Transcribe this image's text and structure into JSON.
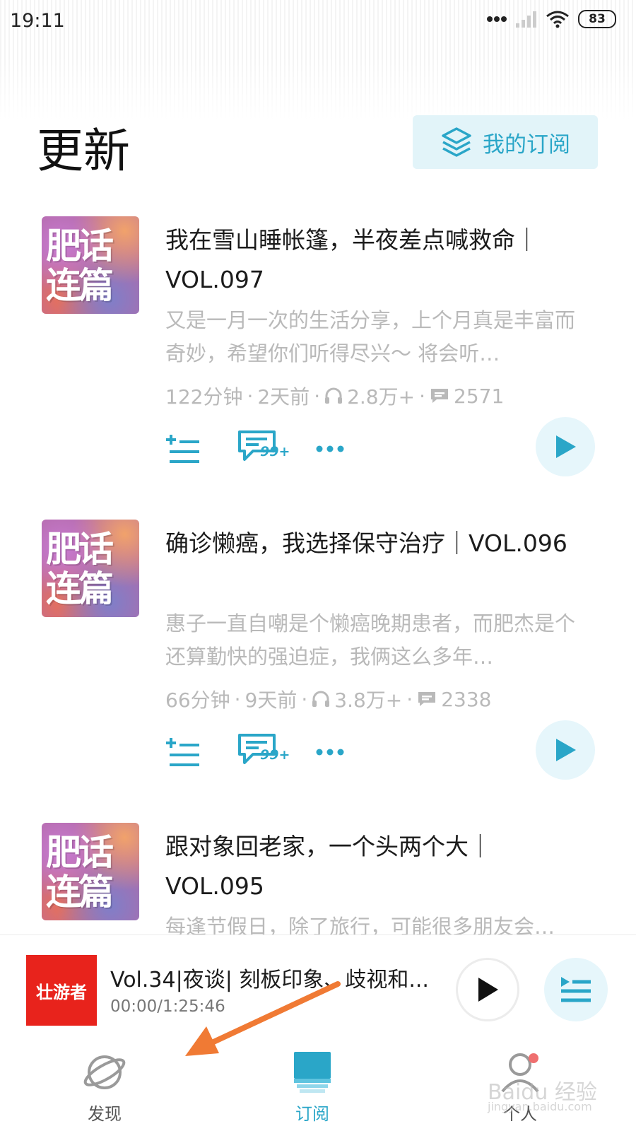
{
  "status_bar": {
    "time": "19:11",
    "battery": "83"
  },
  "header": {
    "title": "更新",
    "my_subscriptions_label": "我的订阅"
  },
  "episodes": [
    {
      "cover_text": "肥话连篇",
      "title": "我在雪山睡帐篷，半夜差点喊救命｜VOL.097",
      "description": "又是一月一次的生活分享，上个月真是丰富而奇妙，希望你们听得尽兴～ 将会听…",
      "duration": "122分钟",
      "age": "2天前",
      "plays": "2.8万+",
      "comments": "2571",
      "comment_badge": "99+"
    },
    {
      "cover_text": "肥话连篇",
      "title": "确诊懒癌，我选择保守治疗｜VOL.096",
      "description": "惠子一直自嘲是个懒癌晚期患者，而肥杰是个还算勤快的强迫症，我俩这么多年…",
      "duration": "66分钟",
      "age": "9天前",
      "plays": "3.8万+",
      "comments": "2338",
      "comment_badge": "99+"
    },
    {
      "cover_text": "肥话连篇",
      "title": "跟对象回老家，一个头两个大｜VOL.095",
      "description": "每逢节假日，除了旅行，可能很多朋友会…"
    }
  ],
  "player": {
    "cover_text": "壮游者",
    "title": "Vol.34|夜谈| 刻板印象、歧视和...",
    "time": "00:00/1:25:46"
  },
  "tabs": [
    {
      "label": "发现"
    },
    {
      "label": "订阅"
    },
    {
      "label": "个人"
    }
  ],
  "watermark": {
    "text": "Baidu 经验",
    "sub": "jingyan.baidu.com"
  },
  "colors": {
    "accent": "#2aa6c8",
    "player_cover": "#e8231c",
    "annotation_arrow": "#f07a34"
  }
}
